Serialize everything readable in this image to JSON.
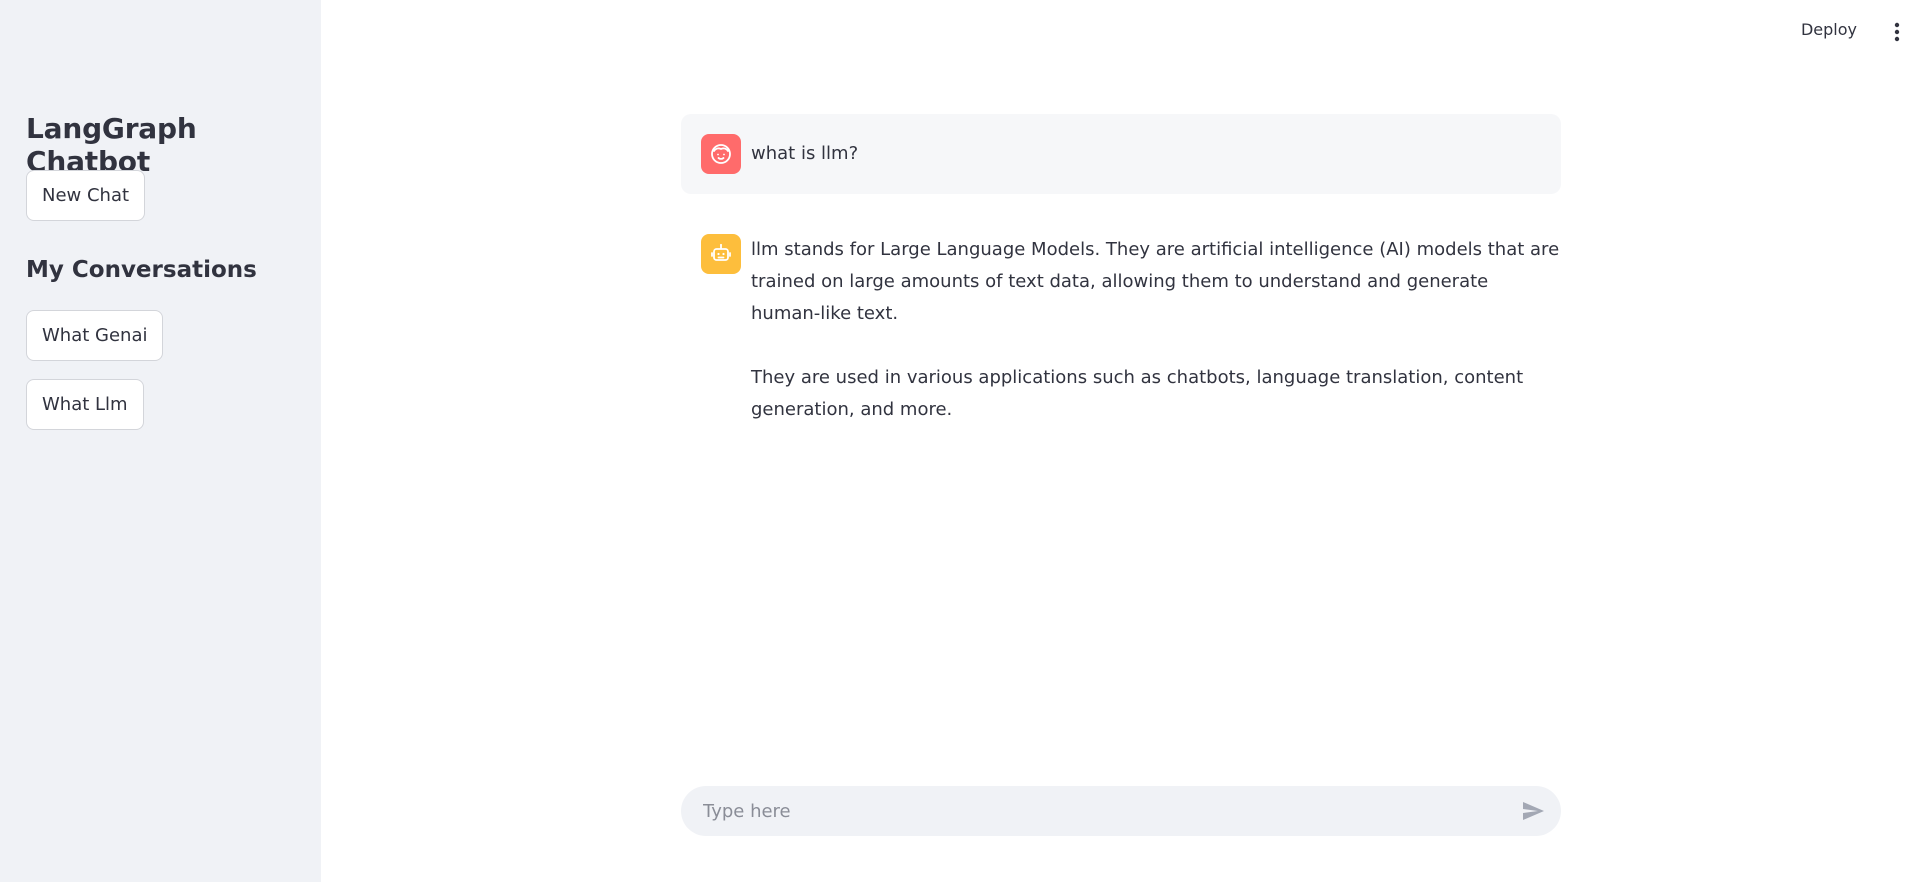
{
  "sidebar": {
    "title": "LangGraph Chatbot",
    "new_chat_label": "New Chat",
    "conversations_heading": "My Conversations",
    "conversations": [
      {
        "label": "What Genai"
      },
      {
        "label": "What Llm"
      }
    ]
  },
  "header": {
    "deploy_label": "Deploy",
    "menu_icon": "more-vertical-icon"
  },
  "chat": {
    "messages": [
      {
        "role": "user",
        "avatar_icon": "user-face-icon",
        "avatar_color": "#ff6b6b",
        "text": "what is llm?"
      },
      {
        "role": "assistant",
        "avatar_icon": "robot-icon",
        "avatar_color": "#fdbe3c",
        "paragraphs": [
          "llm stands for Large Language Models. They are artificial intelligence (AI) models that are trained on large amounts of text data, allowing them to understand and generate human-like text.",
          "They are used in various applications such as chatbots, language translation, content generation, and more."
        ]
      }
    ]
  },
  "input": {
    "placeholder": "Type here",
    "value": "",
    "send_icon": "send-icon"
  }
}
